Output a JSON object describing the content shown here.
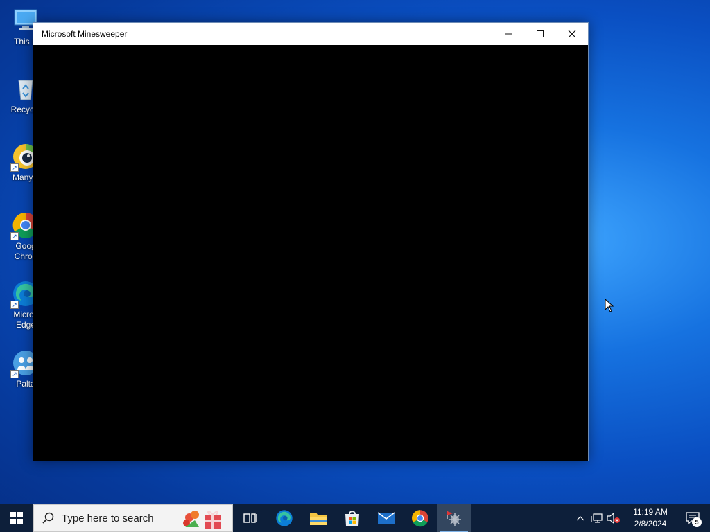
{
  "desktop": {
    "icons": [
      {
        "label": "This PC",
        "icon": "monitor-icon"
      },
      {
        "label": "Recycle Bin",
        "icon": "recycle-bin-icon"
      },
      {
        "label": "ManyCam",
        "icon": "manycam-icon"
      },
      {
        "label": "Google Chrome",
        "icon": "chrome-icon"
      },
      {
        "label": "Microsoft Edge",
        "icon": "edge-icon"
      },
      {
        "label": "Paltalk",
        "icon": "paltalk-icon"
      }
    ],
    "visible_labels": [
      "This P",
      "Recycle",
      "ManyC",
      "Goog\nChron",
      "Micros\nEdge",
      "Palta"
    ]
  },
  "window": {
    "title": "Microsoft Minesweeper",
    "controls": [
      "minimize",
      "maximize",
      "close"
    ]
  },
  "taskbar": {
    "search_placeholder": "Type here to search",
    "apps": [
      {
        "name": "task-view",
        "icon": "task-view-icon"
      },
      {
        "name": "edge",
        "icon": "edge-icon"
      },
      {
        "name": "file-explorer",
        "icon": "folder-icon"
      },
      {
        "name": "store",
        "icon": "store-icon"
      },
      {
        "name": "mail",
        "icon": "mail-icon"
      },
      {
        "name": "chrome",
        "icon": "chrome-icon"
      },
      {
        "name": "minesweeper",
        "icon": "mine-icon",
        "active": true
      }
    ],
    "clock": {
      "time": "11:19 AM",
      "date": "2/8/2024"
    },
    "notifications_count": "5"
  },
  "colors": {
    "taskbar": "#0d1f3a",
    "desktop": "#0a4fc2",
    "window_bg": "#000000"
  }
}
